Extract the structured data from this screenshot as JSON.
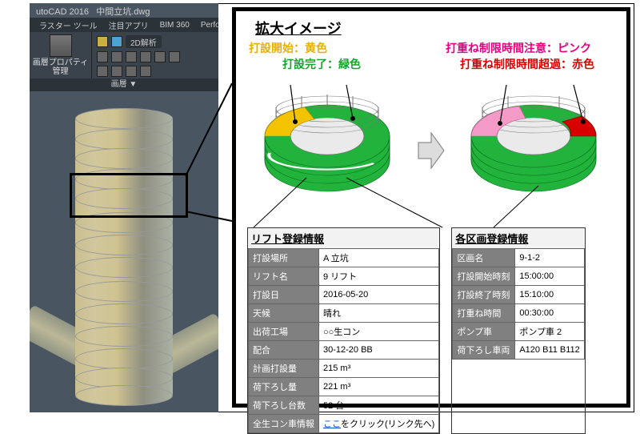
{
  "cad": {
    "titleLeft": "utoCAD 2016",
    "titleRight": "中間立坑.dwg",
    "tabs": [
      "ラスター ツール",
      "注目アプリ",
      "BIM 360",
      "Performa"
    ],
    "panelLabel1": "画層プロパティ",
    "panelLabel2": "管理",
    "chip": "2D解析",
    "footer": "画層 ▼"
  },
  "rp": {
    "title": "拡大イメージ",
    "legend": {
      "startYellow": "打設開始：黄色",
      "doneGreen": "打設完了：緑色",
      "warnPink": "打重ね制限時間注意：ピンク",
      "overRed": "打重ね制限時間超過：赤色"
    }
  },
  "lift": {
    "title": "リフト登録情報",
    "rows": [
      [
        "打設場所",
        "A 立坑"
      ],
      [
        "リフト名",
        "9 リフト"
      ],
      [
        "打設日",
        "2016-05-20"
      ],
      [
        "天候",
        "晴れ"
      ],
      [
        "出荷工場",
        "○○生コン"
      ],
      [
        "配合",
        "30-12-20 BB"
      ],
      [
        "計画打設量",
        "215 m³"
      ],
      [
        "荷下ろし量",
        "221 m³"
      ],
      [
        "荷下ろし台数",
        "52 台"
      ]
    ],
    "lastLabel": "全生コン車情報",
    "linkPre": "ここ",
    "linkSuf": "をクリック(リンク先へ)"
  },
  "block": {
    "title": "各区画登録情報",
    "rows": [
      [
        "区画名",
        "9-1-2"
      ],
      [
        "打設開始時刻",
        "15:00:00"
      ],
      [
        "打設終了時刻",
        "15:10:00"
      ],
      [
        "打重ね時間",
        "00:30:00"
      ],
      [
        "ポンプ車",
        "ポンプ車 2"
      ],
      [
        "荷下ろし車両",
        "A120 B11 B112"
      ]
    ]
  }
}
